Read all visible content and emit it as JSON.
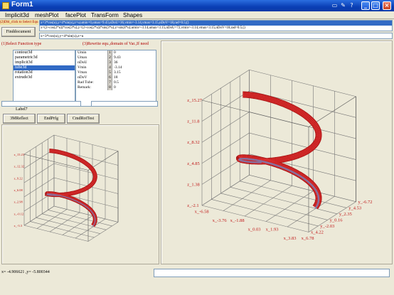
{
  "window": {
    "title": "Form1"
  },
  "menu": [
    "Implicit3d",
    "meshPlot",
    "facePlot",
    "TransForm",
    "Shapes"
  ],
  "equations": {
    "hint": "(2)Dbl_click to Select Equ.",
    "items": [
      "x=3*cos(u),y=4*sin(u),z=u;umin=0,umax=9.43,nDoU=36,vmin=-3.14,vmax=3.15,nDoV=18,rad=0.5;()",
      "x=(2+cos(2*u))*cos(3*u),y=(2+cos(2*u))*sin(3*u),z=sin(4*u);umin=-3.14,umax=3.15,nDoU=72,vmin=-3.14,vmax=3.15,nDoV=18,rad=0.5;()"
    ],
    "current": "x=3*cos(u),y=4*sin(u),z=u"
  },
  "find_button": "Finddocument",
  "select_fn_label": "(1)Select Function type",
  "rewrite_label": "(3)Rewrite equ.,domain of Var.,If need",
  "functions": [
    "contour3d",
    "parametric3d",
    "implicit3d",
    "tube3d",
    "rotation3d",
    "extrude3d"
  ],
  "selected_function": "tube3d",
  "params": [
    {
      "name": "Umin",
      "idx": "1",
      "val": "0"
    },
    {
      "name": "Umax",
      "idx": "2",
      "val": "9.43"
    },
    {
      "name": "nDoU",
      "idx": "3",
      "val": "36"
    },
    {
      "name": "Vmin",
      "idx": "4",
      "val": "-3.14"
    },
    {
      "name": "Vmax",
      "idx": "5",
      "val": "3.15"
    },
    {
      "name": "nDoV",
      "idx": "6",
      "val": "18"
    },
    {
      "name": "Rad Tube:",
      "idx": "7",
      "val": "0.5"
    },
    {
      "name": "Remark:",
      "idx": "8",
      "val": "0"
    }
  ],
  "label7": "Label7",
  "buttons": {
    "reflect": "3MReflect",
    "endfrfg": "EndPrfg",
    "cmdrot": "CmdRotTest"
  },
  "status": "x= -4.906621 ,y= -5.800344",
  "big_plot": {
    "z_ticks": [
      "z_15.27",
      "z_11.8",
      "z_8.32",
      "z_4.85",
      "z_1.38",
      "z_-2.1"
    ],
    "x_ticks": [
      "x_-6.58",
      "x_-3.76",
      "x_-1.88",
      "x_0.03",
      "x_1.93",
      "x_3.83",
      "x_6.78"
    ],
    "y_ticks": [
      "y_-6.72",
      "y_4.53",
      "y_2.35",
      "y_0.16",
      "y_-2.03",
      "x_4.22"
    ]
  },
  "small_plot": {
    "z_ticks": [
      "z_15.23",
      "z_12.32",
      "z_9.22",
      "z_6.08",
      "z_2.98",
      "z_-0.12",
      "z_-3.3"
    ]
  },
  "colors": {
    "tube": "#e03030",
    "accent": "#316ac5"
  }
}
